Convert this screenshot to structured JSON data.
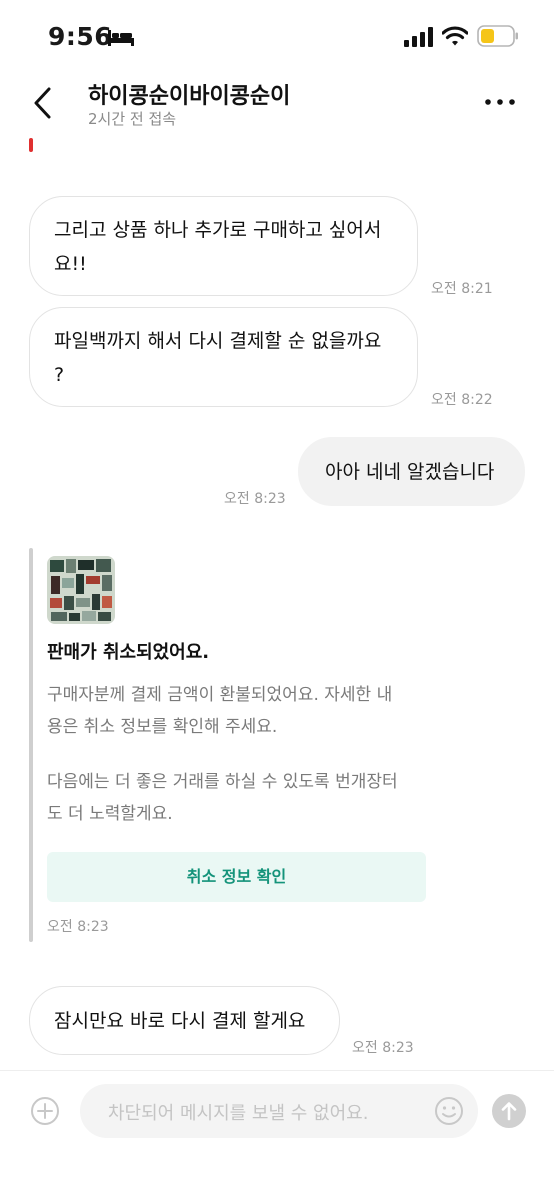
{
  "status_bar": {
    "time": "9:56",
    "icons": [
      "bed-icon",
      "signal-icon",
      "wifi-icon",
      "battery-icon"
    ],
    "battery_color": "#f5c518"
  },
  "header": {
    "title": "하이콩순이바이콩순이",
    "subtitle": "2시간 전 접속"
  },
  "messages": [
    {
      "sender": "other",
      "lines": [
        "그리고 상품 하나 추가로 구매하고 싶어서",
        "요!!"
      ],
      "time": "오전 8:21"
    },
    {
      "sender": "other",
      "lines": [
        "파일백까지 해서 다시 결제할 순 없을까요",
        "?"
      ],
      "time": "오전 8:22"
    },
    {
      "sender": "me",
      "lines": [
        "아아 네네 알겠습니다"
      ],
      "time": "오전 8:23"
    }
  ],
  "system_card": {
    "title": "판매가 취소되었어요.",
    "paragraph1": [
      "구매자분께 결제 금액이 환불되었어요. 자세한 내",
      "용은 취소 정보를 확인해 주세요."
    ],
    "paragraph2": [
      "다음에는 더 좋은 거래를 하실 수 있도록 번개장터",
      "도 더 노력할게요."
    ],
    "button_label": "취소 정보 확인",
    "time": "오전 8:23"
  },
  "last_message": {
    "sender": "other",
    "text": "잠시만요 바로 다시 결제 할게요",
    "time": "오전 8:23"
  },
  "input": {
    "placeholder": "차단되어 메시지를 보낼 수 없어요."
  },
  "colors": {
    "accent_green": "#14937a",
    "button_bg": "#eaf8f4",
    "my_bubble": "#f2f2f2"
  }
}
